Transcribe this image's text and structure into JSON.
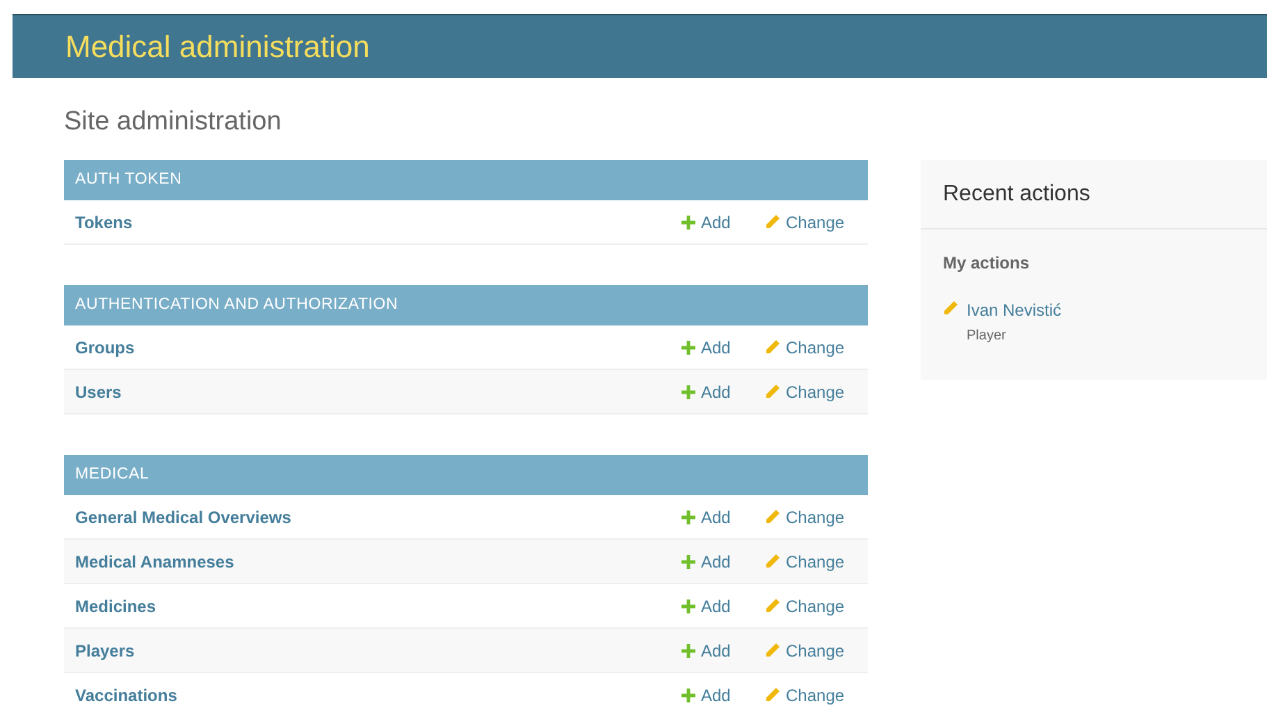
{
  "header": {
    "title": "Medical administration"
  },
  "page_title": "Site administration",
  "modules": [
    {
      "caption": "AUTH TOKEN",
      "models": [
        {
          "name": "Tokens",
          "add": "Add",
          "change": "Change"
        }
      ]
    },
    {
      "caption": "AUTHENTICATION AND AUTHORIZATION",
      "models": [
        {
          "name": "Groups",
          "add": "Add",
          "change": "Change"
        },
        {
          "name": "Users",
          "add": "Add",
          "change": "Change"
        }
      ]
    },
    {
      "caption": "MEDICAL",
      "models": [
        {
          "name": "General Medical Overviews",
          "add": "Add",
          "change": "Change"
        },
        {
          "name": "Medical Anamneses",
          "add": "Add",
          "change": "Change"
        },
        {
          "name": "Medicines",
          "add": "Add",
          "change": "Change"
        },
        {
          "name": "Players",
          "add": "Add",
          "change": "Change"
        },
        {
          "name": "Vaccinations",
          "add": "Add",
          "change": "Change"
        }
      ]
    }
  ],
  "recent_actions": {
    "title": "Recent actions",
    "subtitle": "My actions",
    "items": [
      {
        "kind": "change",
        "name": "Ivan Nevistić",
        "type": "Player"
      }
    ]
  }
}
